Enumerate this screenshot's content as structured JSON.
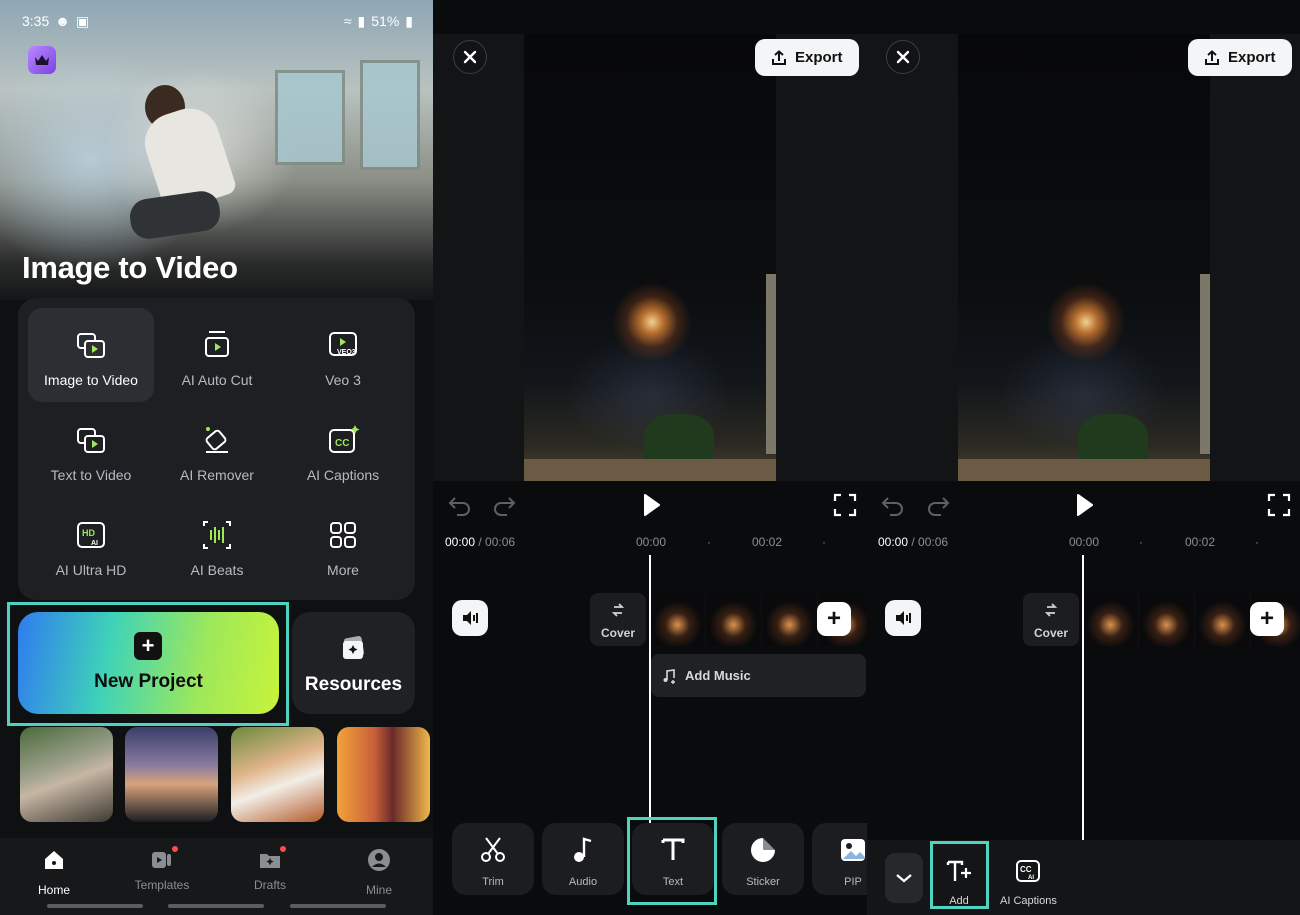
{
  "status_bar": {
    "time": "3:35",
    "battery": "51%"
  },
  "home": {
    "hero_title": "Image to Video",
    "tools": [
      {
        "label": "Image to Video",
        "icon": "image-to-video-icon"
      },
      {
        "label": "AI Auto Cut",
        "icon": "ai-auto-cut-icon"
      },
      {
        "label": "Veo 3",
        "icon": "veo3-icon"
      },
      {
        "label": "Text to Video",
        "icon": "text-to-video-icon"
      },
      {
        "label": "AI Remover",
        "icon": "ai-remover-icon"
      },
      {
        "label": "AI Captions",
        "icon": "ai-captions-icon"
      },
      {
        "label": "AI Ultra HD",
        "icon": "ai-ultra-hd-icon"
      },
      {
        "label": "AI Beats",
        "icon": "ai-beats-icon"
      },
      {
        "label": "More",
        "icon": "more-grid-icon"
      }
    ],
    "new_project_label": "New Project",
    "resources_label": "Resources",
    "nav": [
      {
        "label": "Home",
        "icon": "home-icon"
      },
      {
        "label": "Templates",
        "icon": "templates-icon"
      },
      {
        "label": "Drafts",
        "icon": "drafts-icon"
      },
      {
        "label": "Mine",
        "icon": "profile-icon"
      }
    ]
  },
  "editor": {
    "export_label": "Export",
    "current_time": "00:00",
    "total_time": " / 00:06",
    "ruler_marks": [
      "00:00",
      "00:02"
    ],
    "cover_label": "Cover",
    "add_music_label": "Add Music",
    "toolbar": [
      {
        "label": "Trim",
        "icon": "scissors-icon"
      },
      {
        "label": "Audio",
        "icon": "music-note-icon"
      },
      {
        "label": "Text",
        "icon": "text-icon"
      },
      {
        "label": "Sticker",
        "icon": "sticker-icon"
      },
      {
        "label": "PIP",
        "icon": "pip-icon"
      }
    ]
  },
  "text_panel": {
    "items": [
      {
        "label": "Add",
        "icon": "add-text-icon"
      },
      {
        "label": "AI Captions",
        "icon": "ai-captions-icon"
      }
    ]
  },
  "colors": {
    "highlight": "#4fd3c0",
    "accent_gradient_start": "#2f7bf0",
    "accent_gradient_end": "#c8f43a"
  }
}
